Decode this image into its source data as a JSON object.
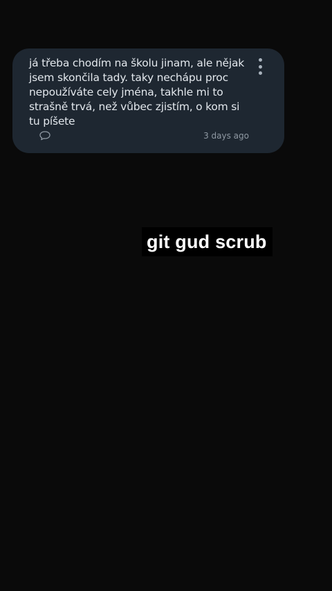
{
  "comment": {
    "text": "já třeba chodím na školu jinam, ale nějak jsem skončila tady. taky nechápu proc nepoužíváte cely jména, takhle mi to strašně trvá, než vůbec zjistím, o kom si tu píšete",
    "timestamp": "3 days ago",
    "reply_icon": "speech-bubble-icon",
    "menu_icon": "vertical-ellipsis-icon"
  },
  "overlay_caption": "git gud scrub",
  "colors": {
    "background": "#0a0a0a",
    "card": "#1e2731",
    "text": "#e2e7ec",
    "muted": "#8f99a3"
  }
}
